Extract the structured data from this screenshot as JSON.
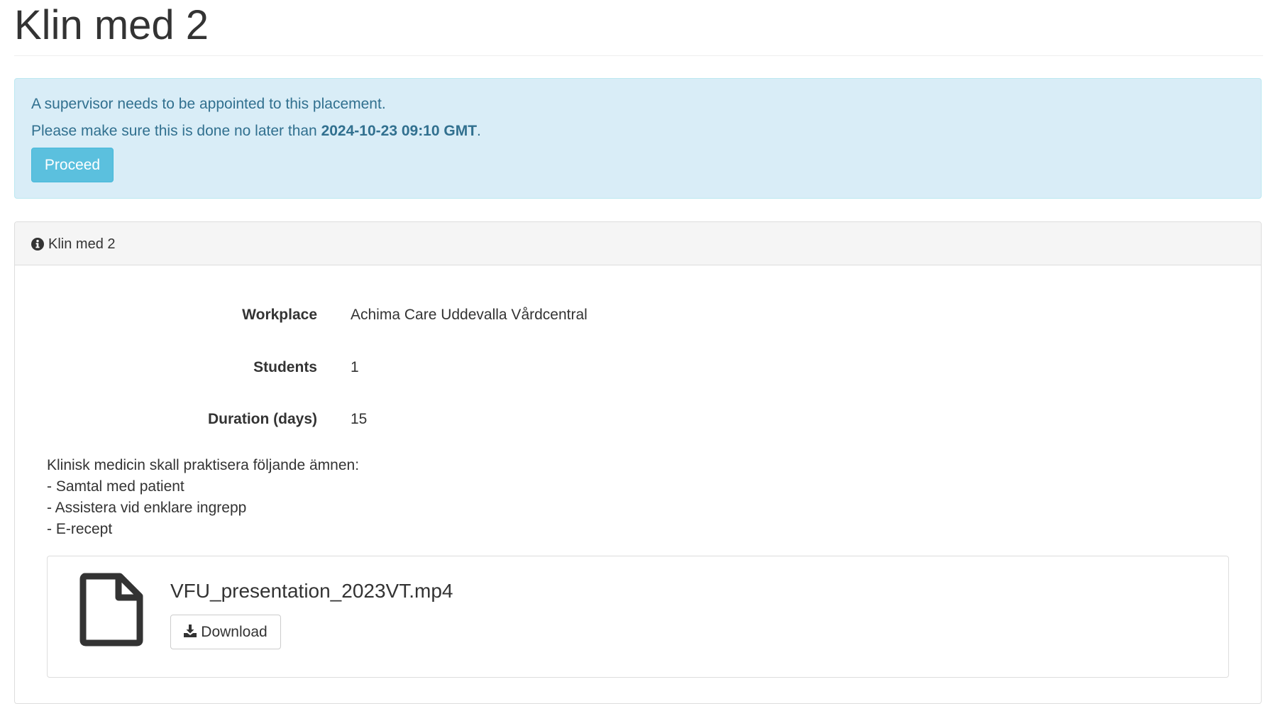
{
  "page": {
    "title": "Klin med 2"
  },
  "alert": {
    "message": "A supervisor needs to be appointed to this placement.",
    "deadline_prefix": "Please make sure this is done no later than ",
    "deadline": "2024-10-23 09:10 GMT",
    "deadline_suffix": ".",
    "proceed_label": "Proceed",
    "color": "#31708f",
    "background": "#d9edf7",
    "button_color": "#5bc0de"
  },
  "panel": {
    "icon": "info-circle-icon",
    "title": "Klin med 2",
    "details": [
      {
        "label": "Workplace",
        "value": "Achima Care Uddevalla Vårdcentral"
      },
      {
        "label": "Students",
        "value": "1"
      },
      {
        "label": "Duration (days)",
        "value": "15"
      }
    ],
    "description": [
      "Klinisk medicin skall praktisera följande ämnen:",
      "- Samtal med patient",
      "- Assistera vid enklare ingrepp",
      "- E-recept"
    ],
    "file": {
      "icon": "file-icon",
      "name": "VFU_presentation_2023VT.mp4",
      "download_icon": "download-icon",
      "download_label": "Download"
    }
  }
}
